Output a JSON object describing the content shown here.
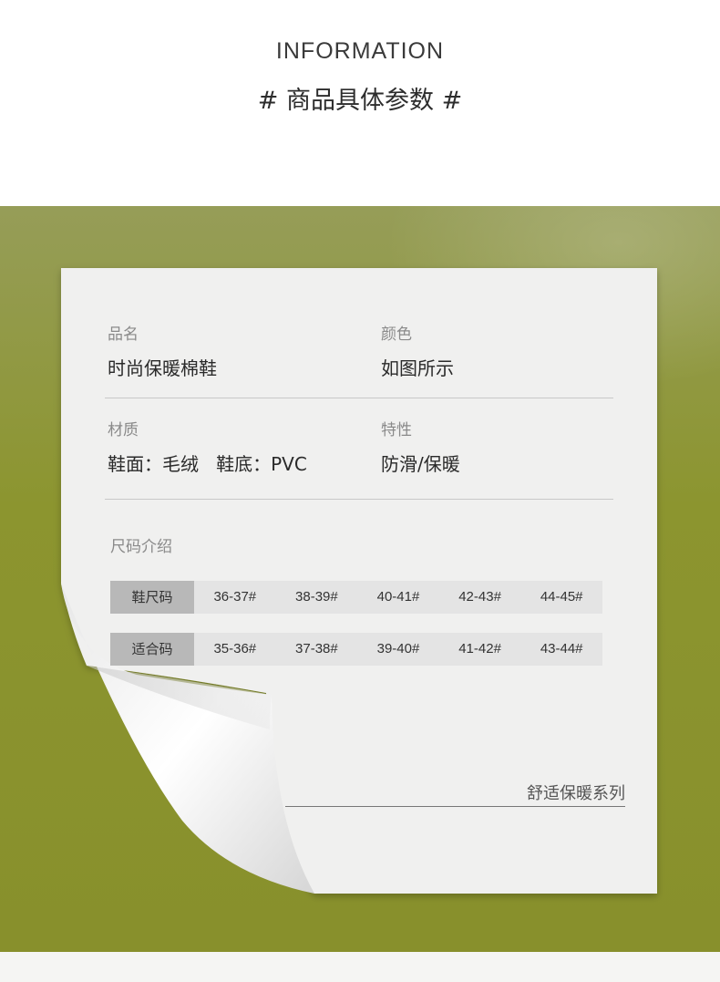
{
  "header": {
    "en_title": "INFORMATION",
    "cn_title": "# 商品具体参数 #"
  },
  "colors": {
    "band": "#8c952f",
    "paper": "#f0f0ef",
    "size_head_bg": "#b8b8b8",
    "size_cell_bg": "#e4e4e4"
  },
  "specs": {
    "name_label": "品名",
    "name_value": "时尚保暖棉鞋",
    "color_label": "颜色",
    "color_value": "如图所示",
    "material_label": "材质",
    "material_value": "鞋面：毛绒   鞋底：PVC",
    "feature_label": "特性",
    "feature_value": "防滑/保暖",
    "size_label": "尺码介绍"
  },
  "size_table": {
    "rows": [
      {
        "header": "鞋尺码",
        "cells": [
          "36-37#",
          "38-39#",
          "40-41#",
          "42-43#",
          "44-45#"
        ]
      },
      {
        "header": "适合码",
        "cells": [
          "35-36#",
          "37-38#",
          "39-40#",
          "41-42#",
          "43-44#"
        ]
      }
    ]
  },
  "series_text": "舒适保暖系列"
}
